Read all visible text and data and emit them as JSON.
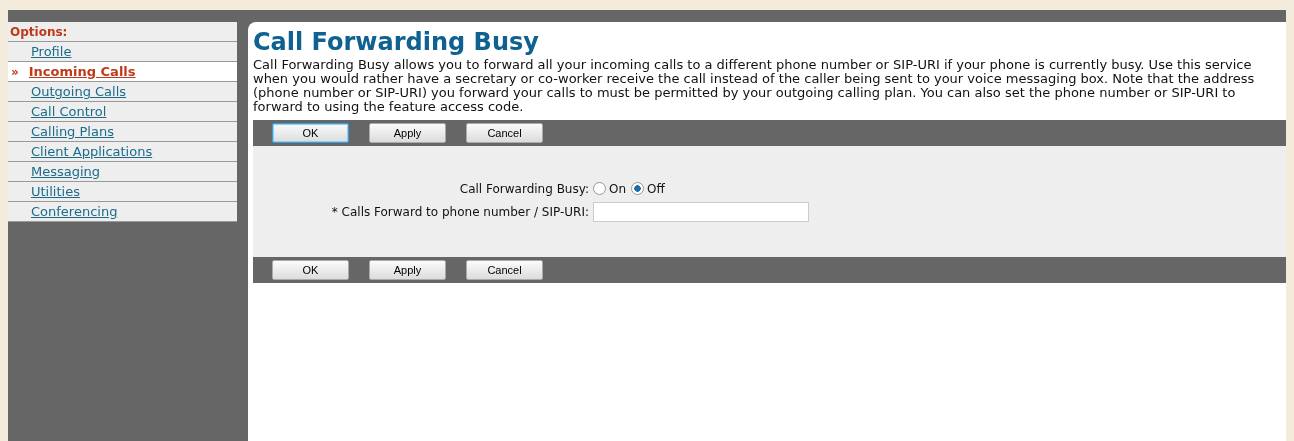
{
  "sidebar": {
    "heading": "Options:",
    "items": [
      {
        "label": "Profile",
        "selected": false
      },
      {
        "label": "Incoming Calls",
        "selected": true
      },
      {
        "label": "Outgoing Calls",
        "selected": false
      },
      {
        "label": "Call Control",
        "selected": false
      },
      {
        "label": "Calling Plans",
        "selected": false
      },
      {
        "label": "Client Applications",
        "selected": false
      },
      {
        "label": "Messaging",
        "selected": false
      },
      {
        "label": "Utilities",
        "selected": false
      },
      {
        "label": "Conferencing",
        "selected": false
      }
    ],
    "marker": "»"
  },
  "page": {
    "title": "Call Forwarding Busy",
    "description": "Call Forwarding Busy allows you to forward all your incoming calls to a different phone number or SIP-URI if your phone is currently busy. Use this service when you would rather have a secretary or co-worker receive the call instead of the caller being sent to your voice messaging box. Note that the address (phone number or SIP-URI) you forward your calls to must be permitted by your outgoing calling plan. You can also set the phone number or SIP-URI to forward to using the feature access code."
  },
  "top_buttons": [
    {
      "label": "OK",
      "focused": true
    },
    {
      "label": "Apply",
      "focused": false
    },
    {
      "label": "Cancel",
      "focused": false
    }
  ],
  "form": {
    "toggle": {
      "label": "Call Forwarding Busy:",
      "options": [
        {
          "label": "On",
          "selected": false
        },
        {
          "label": "Off",
          "selected": true
        }
      ]
    },
    "field": {
      "label": "* Calls Forward to phone number / SIP-URI:"
    }
  },
  "bottom_buttons": [
    {
      "label": "OK",
      "focused": false
    },
    {
      "label": "Apply",
      "focused": false
    },
    {
      "label": "Cancel",
      "focused": false
    }
  ]
}
